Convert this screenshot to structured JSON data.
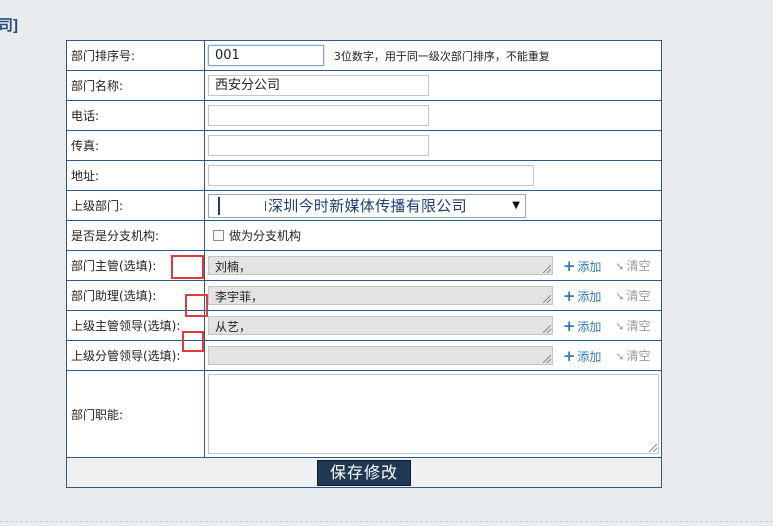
{
  "page": {
    "heading": "司]"
  },
  "form": {
    "sort_no": {
      "label": "部门排序号:",
      "value": "001",
      "hint": "3位数字，用于同一级次部门排序，不能重复"
    },
    "name": {
      "label": "部门名称:",
      "value": "西安分公司"
    },
    "phone": {
      "label": "电话:",
      "value": ""
    },
    "fax": {
      "label": "传真:",
      "value": ""
    },
    "address": {
      "label": "地址:",
      "value": ""
    },
    "parent": {
      "label": "上级部门:",
      "selected": "深圳今时新媒体传播有限公司",
      "arrow": "▼"
    },
    "is_branch": {
      "label": "是否是分支机构:",
      "checkbox_label": "做为分支机构",
      "checked": false
    },
    "manager": {
      "label": "部门主管(选填):",
      "value": "刘楠，"
    },
    "assistant": {
      "label": "部门助理(选填):",
      "value": "李宇菲，"
    },
    "superior_leader": {
      "label": "上级主管领导(选填):",
      "value": "从艺，"
    },
    "division_leader": {
      "label": "上级分管领导(选填):",
      "value": ""
    },
    "duties": {
      "label": "部门职能:",
      "value": ""
    },
    "actions": {
      "add": "添加",
      "clear": "清空",
      "add_icon": "plus-icon",
      "clear_icon": "eraser-icon"
    },
    "save_label": "保存修改"
  },
  "colors": {
    "border": "#2f5a86",
    "accent": "#2e7bc4",
    "highlight": "#e13a3a",
    "button": "#1f3955"
  }
}
